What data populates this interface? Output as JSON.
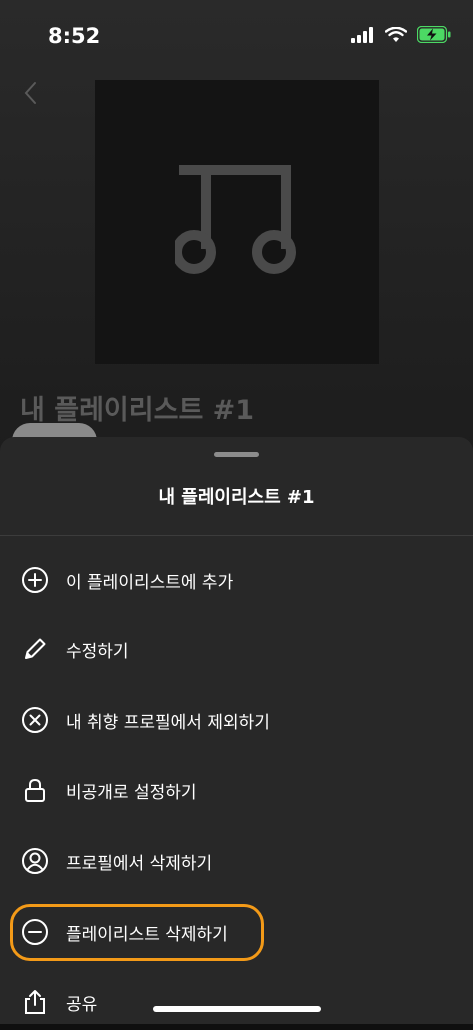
{
  "status_bar": {
    "time": "8:52",
    "battery": "charging"
  },
  "background": {
    "playlist_title": "내 플레이리스트 #1"
  },
  "sheet": {
    "title": "내 플레이리스트 #1",
    "items": [
      {
        "label": "이 플레이리스트에 추가",
        "icon": "add-circle-icon"
      },
      {
        "label": "수정하기",
        "icon": "pencil-icon"
      },
      {
        "label": "내 취향 프로필에서 제외하기",
        "icon": "remove-x-circle-icon"
      },
      {
        "label": "비공개로 설정하기",
        "icon": "lock-icon"
      },
      {
        "label": "프로필에서 삭제하기",
        "icon": "profile-circle-icon"
      },
      {
        "label": "플레이리스트 삭제하기",
        "icon": "minus-circle-icon",
        "highlighted": true
      },
      {
        "label": "공유",
        "icon": "share-icon"
      }
    ]
  },
  "colors": {
    "highlight": "#f39a18",
    "sheet_bg": "#282828"
  }
}
